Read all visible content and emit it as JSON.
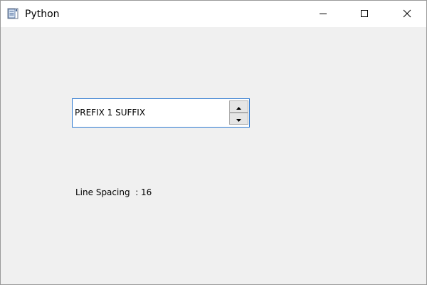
{
  "window": {
    "title": "Python",
    "icons": {
      "app": "python-window-icon",
      "minimize": "minimize-icon",
      "maximize": "maximize-icon",
      "close": "close-icon"
    }
  },
  "spinbox": {
    "value_text": "PREFIX 1 SUFFIX",
    "up_icon": "arrow-up-icon",
    "down_icon": "arrow-down-icon",
    "border_color": "#2f7ad1"
  },
  "info": {
    "line_spacing_text": "Line Spacing  : 16"
  }
}
